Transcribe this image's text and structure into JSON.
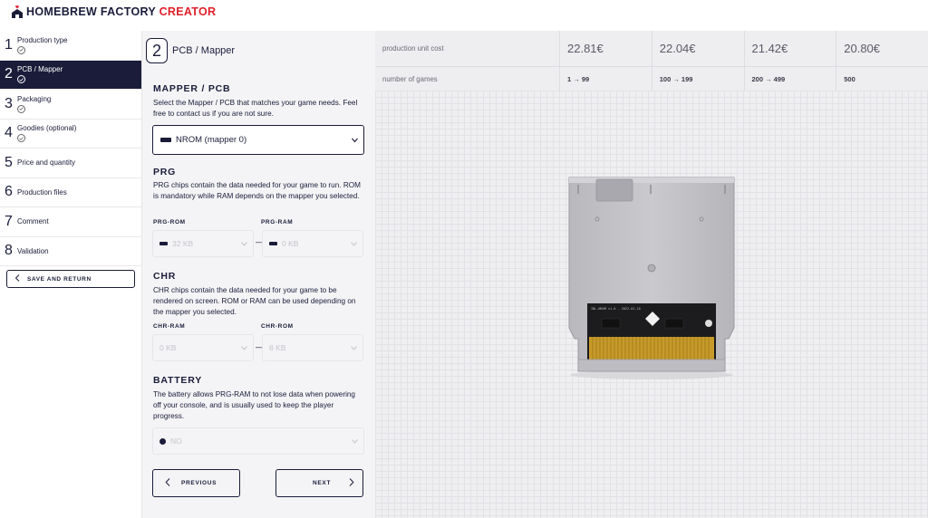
{
  "app": {
    "logo_main": "HOMEBREW FACTORY",
    "logo_accent": "CREATOR",
    "brand_color": "#e0202a",
    "dark_color": "#1a1c3a"
  },
  "sidebar": {
    "steps": [
      {
        "num": "1",
        "label": "Production type",
        "done": true
      },
      {
        "num": "2",
        "label": "PCB / Mapper",
        "done": true,
        "active": true
      },
      {
        "num": "3",
        "label": "Packaging",
        "done": true
      },
      {
        "num": "4",
        "label": "Goodies (optional)",
        "done": true
      },
      {
        "num": "5",
        "label": "Price and quantity"
      },
      {
        "num": "6",
        "label": "Production files"
      },
      {
        "num": "7",
        "label": "Comment"
      },
      {
        "num": "8",
        "label": "Validation"
      }
    ],
    "save_label": "SAVE AND RETURN"
  },
  "form": {
    "step_num": "2",
    "step_title": "PCB / Mapper",
    "mapper": {
      "title": "MAPPER / PCB",
      "desc": "Select the Mapper / PCB that matches your game needs. Feel free to contact us if you are not sure.",
      "selected": "NROM (mapper 0)"
    },
    "prg": {
      "title": "PRG",
      "desc": "PRG chips contain the data needed for your game to run. ROM is mandatory while RAM depends on the mapper you selected.",
      "rom_label": "PRG-ROM",
      "rom_value": "32 KB",
      "ram_label": "PRG-RAM",
      "ram_value": "0 KB",
      "sep": "—"
    },
    "chr": {
      "title": "CHR",
      "desc": "CHR chips contain the data needed for your game to be rendered on screen. ROM or RAM can be used depending on the mapper you selected.",
      "ram_label": "CHR-RAM",
      "ram_value": "0 KB",
      "rom_label": "CHR-ROM",
      "rom_value": "8 KB",
      "sep": "—"
    },
    "battery": {
      "title": "BATTERY",
      "desc": "The battery allows PRG-RAM to not lose data when powering off your console, and is usually used to keep the player progress.",
      "value": "NO"
    },
    "prev_label": "PREVIOUS",
    "next_label": "NEXT"
  },
  "pricing": {
    "cost_label": "production unit cost",
    "games_label": "number of games",
    "costs": [
      "22.81€",
      "22.04€",
      "21.42€",
      "20.80€"
    ],
    "ranges": [
      "1 → 99",
      "100 → 199",
      "200 → 499",
      "500"
    ]
  },
  "cartridge": {
    "pcb_text": "INL-NROM v1.0 - 2022-01-10"
  }
}
